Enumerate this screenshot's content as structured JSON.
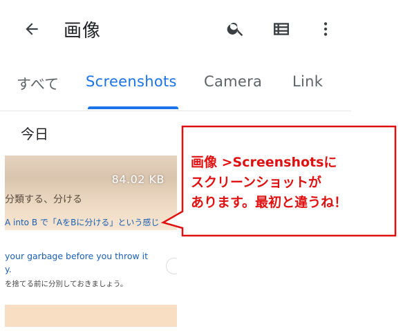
{
  "appbar": {
    "title": "画像",
    "icons": {
      "back": "arrow-left-icon",
      "search": "search-icon",
      "list": "list-view-icon",
      "more": "more-vert-icon"
    }
  },
  "tabs": [
    {
      "label": "すべて",
      "active": false
    },
    {
      "label": "Screenshots",
      "active": true
    },
    {
      "label": "Camera",
      "active": false
    },
    {
      "label": "Link",
      "active": false
    }
  ],
  "section": {
    "heading": "今日"
  },
  "thumbnail": {
    "filesize": "84.02 KB",
    "lines": [
      "分類する、分ける",
      "A into B で「AをBに分ける」という感じ",
      " your garbage before you throw it",
      "y.",
      "を捨てる前に分別しておきましょう。"
    ]
  },
  "annotation": {
    "text": "画像 >Screenshotsに\nスクリーンショットが\nあります。最初と違うね！",
    "color": "#e01010"
  },
  "colors": {
    "accent": "#1a73e8",
    "text": "#202124",
    "secondary_text": "#5f6368"
  }
}
